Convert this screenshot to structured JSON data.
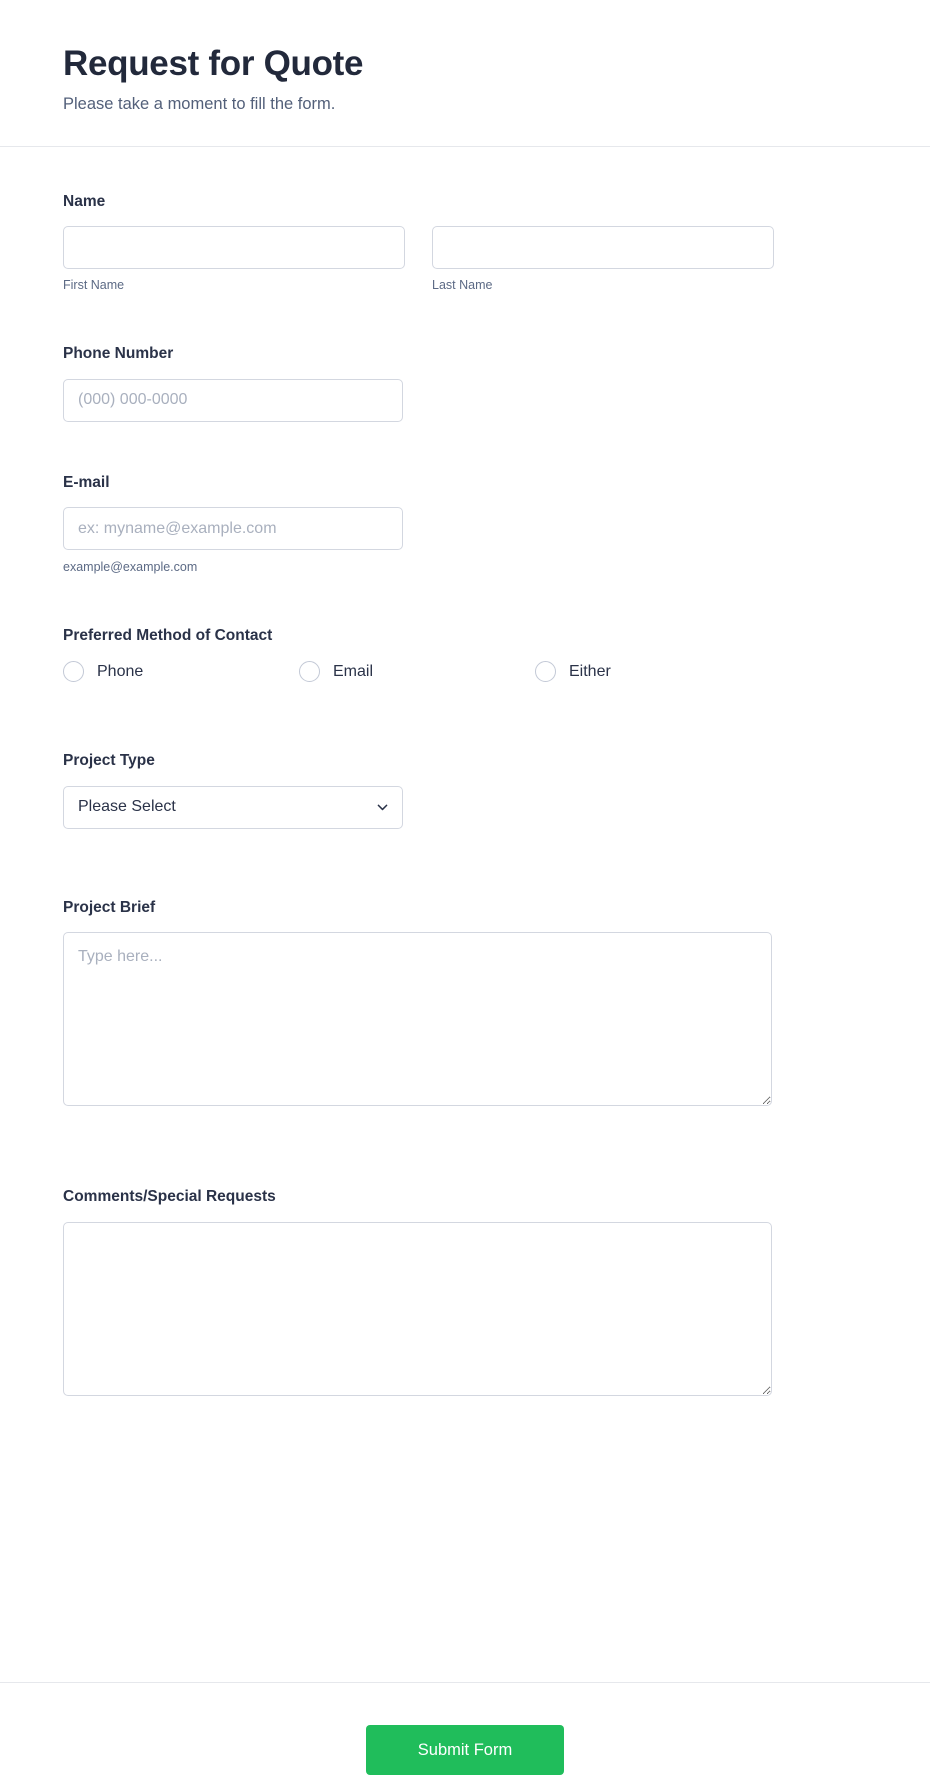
{
  "header": {
    "title": "Request for Quote",
    "subtitle": "Please take a moment to fill the form."
  },
  "fields": {
    "name": {
      "label": "Name",
      "first": {
        "value": "",
        "placeholder": "",
        "sublabel": "First Name"
      },
      "last": {
        "value": "",
        "placeholder": "",
        "sublabel": "Last Name"
      }
    },
    "phone": {
      "label": "Phone Number",
      "value": "",
      "placeholder": "(000) 000-0000"
    },
    "email": {
      "label": "E-mail",
      "value": "",
      "placeholder": "ex: myname@example.com",
      "hint": "example@example.com"
    },
    "contact_method": {
      "label": "Preferred Method of Contact",
      "options": [
        {
          "label": "Phone",
          "selected": false
        },
        {
          "label": "Email",
          "selected": false
        },
        {
          "label": "Either",
          "selected": false
        }
      ]
    },
    "project_type": {
      "label": "Project Type",
      "selected": "Please Select",
      "icon": "chevron-down-icon"
    },
    "project_brief": {
      "label": "Project Brief",
      "value": "",
      "placeholder": "Type here..."
    },
    "comments": {
      "label": "Comments/Special Requests",
      "value": "",
      "placeholder": ""
    }
  },
  "footer": {
    "submit_label": "Submit Form"
  },
  "colors": {
    "accent": "#20bd5b",
    "title": "#22293b",
    "text": "#2a3248",
    "muted": "#5c6a85",
    "placeholder": "#a9b0be",
    "border": "#d3d7e0"
  }
}
